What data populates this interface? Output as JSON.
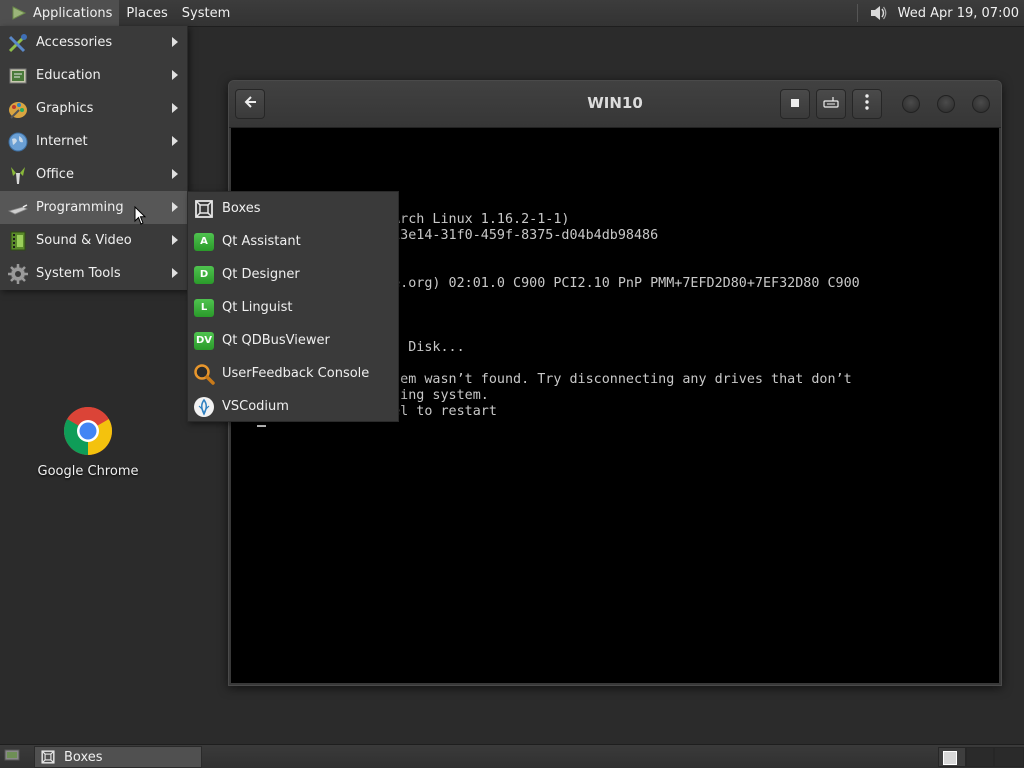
{
  "top_panel": {
    "menus": [
      "Applications",
      "Places",
      "System"
    ],
    "clock": "Wed Apr 19, 07:00"
  },
  "desktop": {
    "icons": [
      {
        "label": "Google Chrome",
        "icon": "chrome-icon"
      }
    ]
  },
  "boxes_window": {
    "title": "WIN10",
    "console_lines": [
      "                  Arch Linux 1.16.2-1-1)",
      "                  13e14-31f0-459f-8375-d04b4db98486",
      "                  e.org) 02:01.0 C900 PCI2.10 PnP PMM+7EFD2D80+7EF32D80 C900",
      "                  d Disk...",
      "                  tem wasn’t found. Try disconnecting any drives that don’t",
      "                  ting system.",
      "                  el to restart"
    ]
  },
  "apps_menu": {
    "items": [
      {
        "label": "Accessories",
        "icon": "accessories-icon"
      },
      {
        "label": "Education",
        "icon": "education-icon"
      },
      {
        "label": "Graphics",
        "icon": "graphics-icon"
      },
      {
        "label": "Internet",
        "icon": "internet-icon"
      },
      {
        "label": "Office",
        "icon": "office-icon"
      },
      {
        "label": "Programming",
        "icon": "programming-icon"
      },
      {
        "label": "Sound & Video",
        "icon": "sound-video-icon"
      },
      {
        "label": "System Tools",
        "icon": "system-tools-icon"
      }
    ],
    "programming_submenu": [
      {
        "label": "Boxes",
        "icon": "boxes-icon"
      },
      {
        "label": "Qt Assistant",
        "icon": "qt-assistant-icon",
        "badge": "A"
      },
      {
        "label": "Qt Designer",
        "icon": "qt-designer-icon",
        "badge": "D"
      },
      {
        "label": "Qt Linguist",
        "icon": "qt-linguist-icon",
        "badge": "L"
      },
      {
        "label": "Qt QDBusViewer",
        "icon": "qt-qdbusviewer-icon",
        "badge": "DV"
      },
      {
        "label": "UserFeedback Console",
        "icon": "userfeedback-console-icon"
      },
      {
        "label": "VSCodium",
        "icon": "vscodium-icon"
      }
    ]
  },
  "bottom_panel": {
    "tasks": [
      {
        "label": "Boxes",
        "icon": "boxes-icon"
      }
    ]
  },
  "colors": {
    "panel_bg": "#363636",
    "menu_bg": "#3a3a3a",
    "menu_highlight": "#575757",
    "qt_green": "#3cb43c"
  }
}
